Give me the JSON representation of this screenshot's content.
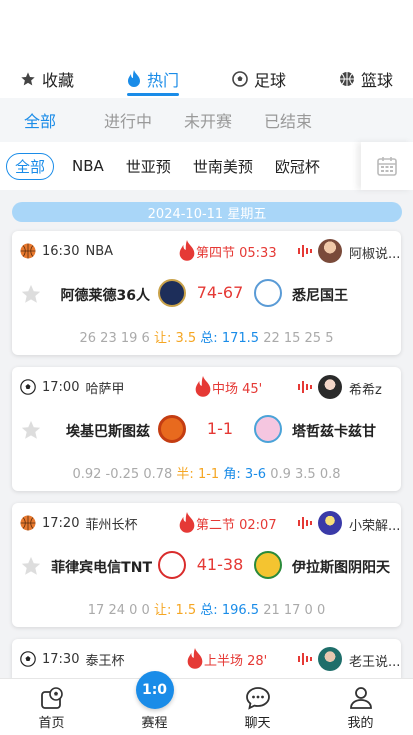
{
  "category_tabs": [
    {
      "label": "收藏",
      "icon": "star-icon"
    },
    {
      "label": "热门",
      "icon": "flame-icon"
    },
    {
      "label": "足球",
      "icon": "soccer-ball-icon"
    },
    {
      "label": "篮球",
      "icon": "basketball-icon"
    }
  ],
  "status_tabs": [
    "全部",
    "进行中",
    "未开赛",
    "已结束"
  ],
  "leagues": [
    "全部",
    "NBA",
    "世亚预",
    "世南美预",
    "欧冠杯"
  ],
  "date_banner": "2024-10-11 星期五",
  "matches": [
    {
      "sport": "basketball",
      "time": "16:30",
      "league": "NBA",
      "live_status": "第四节 05:33",
      "anchor": "阿椒说...",
      "home": "阿德莱德36人",
      "score": "74-67",
      "away": "悉尼国王",
      "odds_left": "26 23 19 6",
      "handicap_label": "让:",
      "handicap": "3.5",
      "total_label": "总:",
      "total": "171.5",
      "odds_right": "22 15 25 5"
    },
    {
      "sport": "soccer",
      "time": "17:00",
      "league": "哈萨甲",
      "live_status": "中场 45'",
      "anchor": "希希z",
      "home": "埃基巴斯图兹",
      "score": "1-1",
      "away": "塔哲兹卡兹甘",
      "odds_left": "0.92 -0.25 0.78",
      "handicap_label": "半:",
      "handicap": "1-1",
      "total_label": "角:",
      "total": "3-6",
      "odds_right": "0.9 3.5 0.8"
    },
    {
      "sport": "basketball",
      "time": "17:20",
      "league": "菲州长杯",
      "live_status": "第二节 02:07",
      "anchor": "小荣解...",
      "home": "菲律宾电信TNT",
      "score": "41-38",
      "away": "伊拉斯图阴阳天",
      "odds_left": "17 24 0 0",
      "handicap_label": "让:",
      "handicap": "1.5",
      "total_label": "总:",
      "total": "196.5",
      "odds_right": "21 17 0 0"
    },
    {
      "sport": "soccer",
      "time": "17:30",
      "league": "泰王杯",
      "live_status": "上半场 28'",
      "anchor": "老王说..."
    }
  ],
  "bottom_nav": [
    {
      "label": "首页",
      "icon": "home-ball-icon"
    },
    {
      "label": "赛程",
      "icon": "schedule-icon",
      "badge": "1:0"
    },
    {
      "label": "聊天",
      "icon": "chat-icon"
    },
    {
      "label": "我的",
      "icon": "profile-icon"
    }
  ],
  "colors": {
    "accent": "#1a8ce8",
    "live": "#e53935",
    "odds_label": "#f5a623"
  }
}
